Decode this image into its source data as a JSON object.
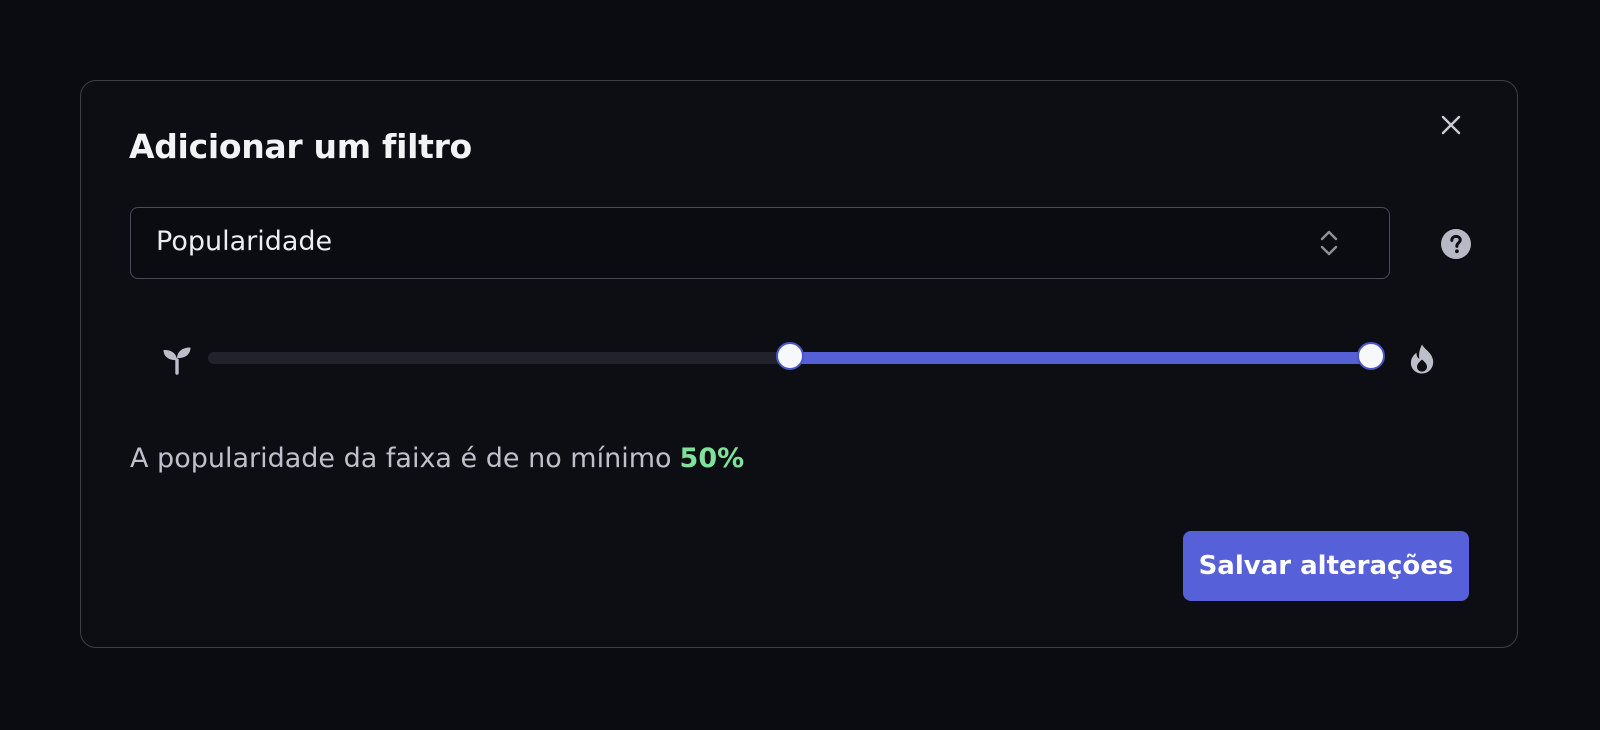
{
  "dialog": {
    "title": "Adicionar um filtro",
    "close_icon": "close-icon"
  },
  "filter_select": {
    "value": "Popularidade",
    "icon": "chevron-up-down-icon"
  },
  "help": {
    "icon": "question-circle-icon"
  },
  "popularity_slider": {
    "min_icon": "sprout-icon",
    "max_icon": "fire-icon",
    "range_min": 0,
    "range_max": 100,
    "lower_value": 50,
    "upper_value": 100
  },
  "summary": {
    "text": "A popularidade da faixa é de no mínimo",
    "value": "50%"
  },
  "actions": {
    "save_label": "Salvar alterações"
  },
  "colors": {
    "accent": "#5660d8",
    "value_highlight": "#7ee29a",
    "background": "#0b0c11",
    "panel": "#0d0e14"
  }
}
